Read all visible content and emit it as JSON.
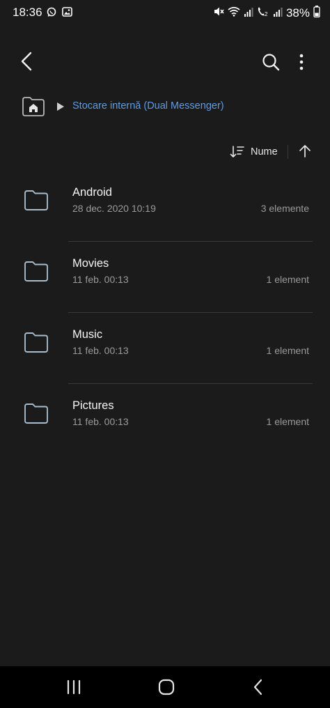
{
  "status_bar": {
    "time": "18:36",
    "battery": "38%",
    "icons": [
      "whatsapp-icon",
      "gallery-icon",
      "mute-icon",
      "wifi-icon",
      "signal-icon",
      "volte-call-icon",
      "signal-icon",
      "battery-icon"
    ]
  },
  "toolbar": {
    "icons": [
      "back-arrow-icon",
      "search-icon",
      "more-options-icon"
    ]
  },
  "breadcrumb": {
    "location": "Stocare internă (Dual Messenger)"
  },
  "sort": {
    "label": "Nume",
    "direction": "ascending"
  },
  "files": [
    {
      "name": "Android",
      "date": "28 dec. 2020 10:19",
      "count": "3 elemente"
    },
    {
      "name": "Movies",
      "date": "11 feb. 00:13",
      "count": "1 element"
    },
    {
      "name": "Music",
      "date": "11 feb. 00:13",
      "count": "1 element"
    },
    {
      "name": "Pictures",
      "date": "11 feb. 00:13",
      "count": "1 element"
    }
  ],
  "colors": {
    "background": "#1b1b1b",
    "accent": "#5b9de8",
    "secondary_text": "#9a9a9a",
    "nav_bar": "#000000"
  }
}
